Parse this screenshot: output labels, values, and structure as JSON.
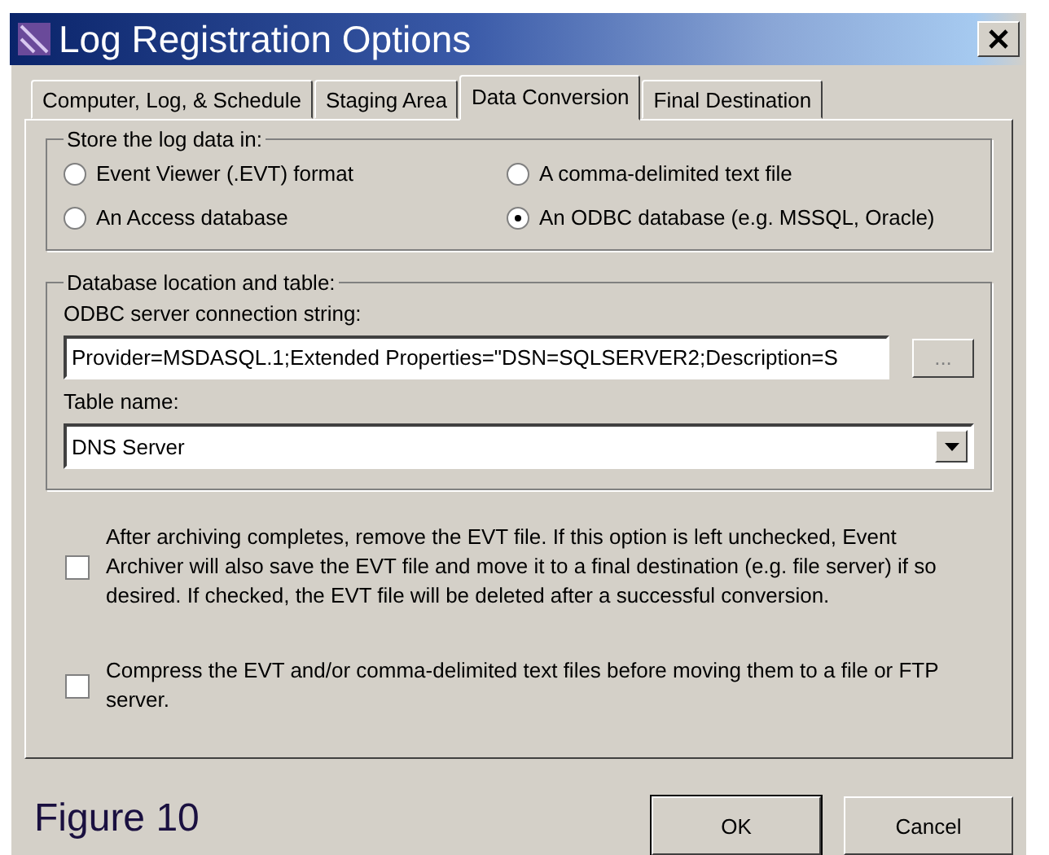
{
  "window": {
    "title": "Log Registration Options"
  },
  "tabs": [
    {
      "label": "Computer, Log, & Schedule",
      "selected": false
    },
    {
      "label": "Staging Area",
      "selected": false
    },
    {
      "label": "Data Conversion",
      "selected": true
    },
    {
      "label": "Final Destination",
      "selected": false
    }
  ],
  "storage_group": {
    "legend": "Store the log data in:",
    "options": [
      {
        "label": "Event Viewer (.EVT) format",
        "selected": false
      },
      {
        "label": "A comma-delimited text file",
        "selected": false
      },
      {
        "label": "An Access database",
        "selected": false
      },
      {
        "label": "An ODBC database (e.g. MSSQL, Oracle)",
        "selected": true
      }
    ]
  },
  "database_group": {
    "legend": "Database location and table:",
    "connection_label": "ODBC server connection string:",
    "connection_value": "Provider=MSDASQL.1;Extended Properties=\"DSN=SQLSERVER2;Description=S",
    "browse_button": "...",
    "table_label": "Table name:",
    "table_value": "DNS Server"
  },
  "checkboxes": [
    {
      "label": "After archiving completes, remove the EVT file.  If this option is left unchecked, Event Archiver will also save the EVT file and move it to a final destination (e.g. file server) if so desired.  If checked, the EVT file will be deleted after a successful conversion.",
      "checked": false
    },
    {
      "label": "Compress the EVT and/or comma-delimited text files before moving them to a file or FTP server.",
      "checked": false
    }
  ],
  "footer": {
    "caption": "Figure 10",
    "buttons": [
      "OK",
      "Cancel"
    ]
  }
}
